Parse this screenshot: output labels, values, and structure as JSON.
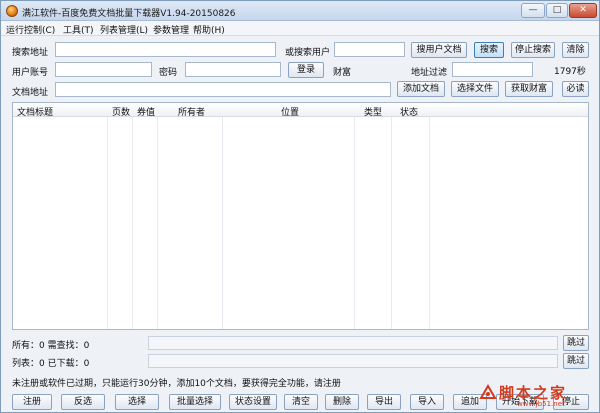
{
  "window": {
    "title": "满江软件-百度免费文档批量下载器V1.94-20150826",
    "controls": {
      "minimize": "—",
      "maximize": "□",
      "close": "✕"
    }
  },
  "menu": [
    {
      "label": "运行控制(C)"
    },
    {
      "label": "工具(T)"
    },
    {
      "label": "列表管理(L)"
    },
    {
      "label": "参数管理"
    },
    {
      "label": "帮助(H)"
    }
  ],
  "form": {
    "search_label": "搜索地址",
    "search_value": "",
    "or_user_label": "或搜索用户",
    "or_user_value": "",
    "user_docs_button": "搜用户文档",
    "search_button": "搜索",
    "stop_search_button": "停止搜索",
    "clear_button": "清除",
    "account_label": "用户账号",
    "account_value": "",
    "password_label": "密码",
    "password_value": "",
    "login_button": "登录",
    "wealth_label": "财富",
    "url_filter_label": "地址过滤",
    "url_filter_value": "",
    "timer": "1797秒",
    "doc_url_label": "文档地址",
    "doc_url_value": "",
    "add_doc_button": "添加文档",
    "select_file_button": "选择文件",
    "get_wealth_button": "获取财富",
    "must_read_button": "必读"
  },
  "table": {
    "columns": [
      "文档标题",
      "页数",
      "券值",
      "所有者",
      "位置",
      "类型",
      "状态"
    ],
    "rows": []
  },
  "status": {
    "all_text": "所有：0 需查找：0",
    "list_text": "列表：0 已下载：0",
    "skip_button_1": "跳过",
    "skip_button_2": "跳过"
  },
  "notice": "未注册或软件已过期，只能运行30分钟，添加10个文档，要获得完全功能，请注册",
  "bottom_buttons": [
    {
      "label": "注册"
    },
    {
      "label": "反选"
    },
    {
      "label": "选择"
    },
    {
      "label": "批量选择"
    },
    {
      "label": "状态设置"
    },
    {
      "label": "清空"
    },
    {
      "label": "删除"
    },
    {
      "label": "导出"
    },
    {
      "label": "导入"
    },
    {
      "label": "追加"
    },
    {
      "label": "开始下载"
    },
    {
      "label": "停止"
    }
  ],
  "watermark": {
    "text": "脚本之家",
    "sub": "www.jb51.net",
    "color": "#d43b1e"
  }
}
